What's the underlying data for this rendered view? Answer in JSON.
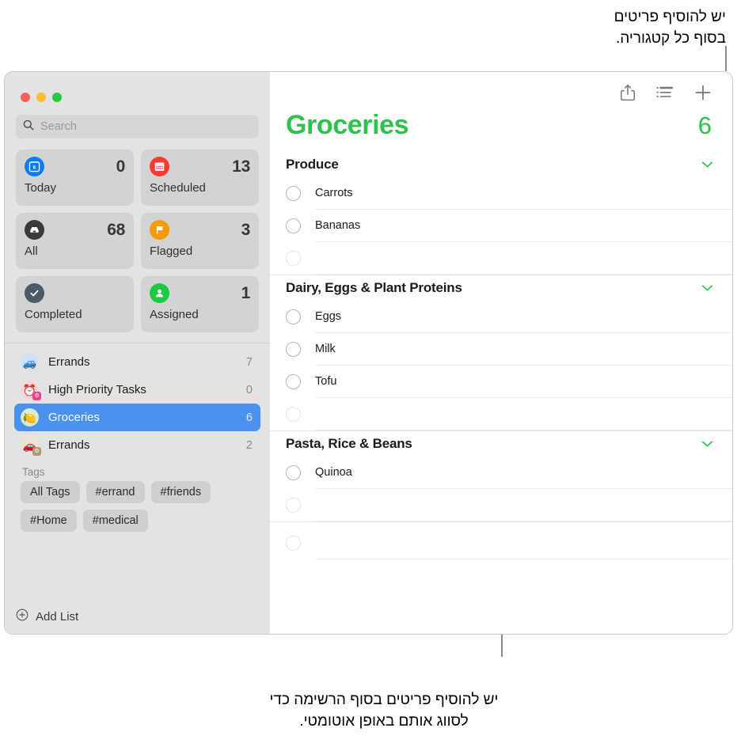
{
  "annotations": {
    "top": "יש להוסיף פריטים\nבסוף כל קטגוריה.",
    "bottom": "יש להוסיף פריטים בסוף הרשימה כדי לסווג אותם באופן אוטומטי."
  },
  "colors": {
    "accent_green": "#2ec14e",
    "selection_blue": "#4b92f0",
    "sidebar_bg": "#e3e3e3",
    "card_bg": "#d3d3d3"
  },
  "window": {
    "traffic_lights": [
      "close",
      "minimize",
      "zoom"
    ]
  },
  "sidebar": {
    "search": {
      "placeholder": "Search",
      "value": ""
    },
    "smart_lists": [
      {
        "label": "Today",
        "count": "0",
        "icon": "calendar-day-icon",
        "icon_color": "#0a7cf5",
        "badge_day": "6"
      },
      {
        "label": "Scheduled",
        "count": "13",
        "icon": "calendar-icon",
        "icon_color": "#f83b31"
      },
      {
        "label": "All",
        "count": "68",
        "icon": "inbox-icon",
        "icon_color": "#3a3a3c"
      },
      {
        "label": "Flagged",
        "count": "3",
        "icon": "flag-icon",
        "icon_color": "#f59a0b"
      },
      {
        "label": "Completed",
        "count": "",
        "icon": "checkmark-icon",
        "icon_color": "#4c5a68"
      },
      {
        "label": "Assigned",
        "count": "1",
        "icon": "person-icon",
        "icon_color": "#1bc943"
      }
    ],
    "lists": [
      {
        "name": "Errands",
        "count": "7",
        "emoji": "🚙",
        "bg": "#cfe0fa",
        "selected": false
      },
      {
        "name": "High Priority Tasks",
        "count": "0",
        "emoji": "⏰",
        "bg": "#fbd2dd",
        "selected": false,
        "badge": "smart",
        "badge_bg": "#f2418c"
      },
      {
        "name": "Groceries",
        "count": "6",
        "emoji": "🍋",
        "bg": "#d8eecb",
        "selected": true
      },
      {
        "name": "Errands",
        "count": "2",
        "emoji": "🚗",
        "bg": "#ece3d6",
        "selected": false,
        "badge": "smart",
        "badge_bg": "#b09778"
      }
    ],
    "tags_header": "Tags",
    "tags": [
      "All Tags",
      "#errand",
      "#friends",
      "#Home",
      "#medical"
    ],
    "add_list_label": "Add List"
  },
  "main": {
    "toolbar": [
      {
        "name": "share-icon",
        "label": "Share"
      },
      {
        "name": "list-view-icon",
        "label": "View Options"
      },
      {
        "name": "add-icon",
        "label": "Add Reminder"
      }
    ],
    "title": "Groceries",
    "total_count": "6",
    "sections": [
      {
        "title": "Produce",
        "collapsed": false,
        "tasks": [
          {
            "text": "Carrots",
            "done": false
          },
          {
            "text": "Bananas",
            "done": false
          }
        ],
        "new_item_placeholder": ""
      },
      {
        "title": "Dairy, Eggs & Plant Proteins",
        "collapsed": false,
        "tasks": [
          {
            "text": "Eggs",
            "done": false
          },
          {
            "text": "Milk",
            "done": false
          },
          {
            "text": "Tofu",
            "done": false
          }
        ],
        "new_item_placeholder": ""
      },
      {
        "title": "Pasta, Rice & Beans",
        "collapsed": false,
        "tasks": [
          {
            "text": "Quinoa",
            "done": false
          }
        ],
        "new_item_placeholder": ""
      }
    ],
    "trailing_new_item_placeholder": ""
  }
}
